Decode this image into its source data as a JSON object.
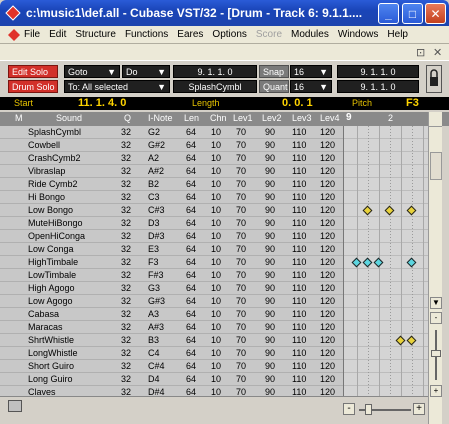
{
  "window": {
    "title": "c:\\music1\\def.all - Cubase VST/32 - [Drum - Track 6:  9.1.1....",
    "min_label": "_",
    "max_label": "□",
    "close_label": "✕"
  },
  "menu": [
    "File",
    "Edit",
    "Structure",
    "Functions",
    "Eares",
    "Options",
    "Score",
    "Modules",
    "Windows",
    "Help"
  ],
  "menu_disabled": "Score",
  "subwindow": {
    "restore_label": "⊡",
    "close_label": "✕",
    "min_label": "-"
  },
  "toolbar": {
    "edit_solo": "Edit Solo",
    "drum_solo": "Drum Solo",
    "goto": "Goto",
    "do": "Do",
    "to_selected": "To: All selected",
    "position1": "9.  1.  1.      0",
    "splash": "SplashCymbl",
    "snap_label": "Snap",
    "snap_value": "16",
    "quant_label": "Quant",
    "quant_value": "16",
    "pos_right1": "9.  1.  1.      0",
    "pos_right2": "9.  1.  1.      0",
    "dropdown_arrow": "▼"
  },
  "info": {
    "start_label": "Start",
    "start_value": "11. 1.  4.    0",
    "length_label": "Length",
    "length_value": "0.  0.    1",
    "pitch_label": "Pitch",
    "pitch_value": "F3"
  },
  "header": {
    "mute": "M",
    "sound": "Sound",
    "q": "Q",
    "inote": "I-Note",
    "len": "Len",
    "chn": "Chn",
    "lev1": "Lev1",
    "lev2": "Lev2",
    "lev3": "Lev3",
    "lev4": "Lev4",
    "bar9": "9",
    "beat2": "2"
  },
  "rows": [
    {
      "sound": "SplashCymbl",
      "q": "32",
      "note": "G2",
      "len": "64",
      "chn": "10",
      "l1": "70",
      "l2": "90",
      "l3": "110",
      "l4": "120"
    },
    {
      "sound": "Cowbell",
      "q": "32",
      "note": "G#2",
      "len": "64",
      "chn": "10",
      "l1": "70",
      "l2": "90",
      "l3": "110",
      "l4": "120"
    },
    {
      "sound": "CrashCymb2",
      "q": "32",
      "note": "A2",
      "len": "64",
      "chn": "10",
      "l1": "70",
      "l2": "90",
      "l3": "110",
      "l4": "120"
    },
    {
      "sound": "Vibraslap",
      "q": "32",
      "note": "A#2",
      "len": "64",
      "chn": "10",
      "l1": "70",
      "l2": "90",
      "l3": "110",
      "l4": "120"
    },
    {
      "sound": "Ride Cymb2",
      "q": "32",
      "note": "B2",
      "len": "64",
      "chn": "10",
      "l1": "70",
      "l2": "90",
      "l3": "110",
      "l4": "120"
    },
    {
      "sound": "Hi Bongo",
      "q": "32",
      "note": "C3",
      "len": "64",
      "chn": "10",
      "l1": "70",
      "l2": "90",
      "l3": "110",
      "l4": "120"
    },
    {
      "sound": "Low Bongo",
      "q": "32",
      "note": "C#3",
      "len": "64",
      "chn": "10",
      "l1": "70",
      "l2": "90",
      "l3": "110",
      "l4": "120"
    },
    {
      "sound": "MuteHiBongo",
      "q": "32",
      "note": "D3",
      "len": "64",
      "chn": "10",
      "l1": "70",
      "l2": "90",
      "l3": "110",
      "l4": "120"
    },
    {
      "sound": "OpenHiConga",
      "q": "32",
      "note": "D#3",
      "len": "64",
      "chn": "10",
      "l1": "70",
      "l2": "90",
      "l3": "110",
      "l4": "120"
    },
    {
      "sound": "Low Conga",
      "q": "32",
      "note": "E3",
      "len": "64",
      "chn": "10",
      "l1": "70",
      "l2": "90",
      "l3": "110",
      "l4": "120"
    },
    {
      "sound": "HighTimbale",
      "q": "32",
      "note": "F3",
      "len": "64",
      "chn": "10",
      "l1": "70",
      "l2": "90",
      "l3": "110",
      "l4": "120"
    },
    {
      "sound": "LowTimbale",
      "q": "32",
      "note": "F#3",
      "len": "64",
      "chn": "10",
      "l1": "70",
      "l2": "90",
      "l3": "110",
      "l4": "120"
    },
    {
      "sound": "High Agogo",
      "q": "32",
      "note": "G3",
      "len": "64",
      "chn": "10",
      "l1": "70",
      "l2": "90",
      "l3": "110",
      "l4": "120"
    },
    {
      "sound": "Low Agogo",
      "q": "32",
      "note": "G#3",
      "len": "64",
      "chn": "10",
      "l1": "70",
      "l2": "90",
      "l3": "110",
      "l4": "120"
    },
    {
      "sound": "Cabasa",
      "q": "32",
      "note": "A3",
      "len": "64",
      "chn": "10",
      "l1": "70",
      "l2": "90",
      "l3": "110",
      "l4": "120"
    },
    {
      "sound": "Maracas",
      "q": "32",
      "note": "A#3",
      "len": "64",
      "chn": "10",
      "l1": "70",
      "l2": "90",
      "l3": "110",
      "l4": "120"
    },
    {
      "sound": "ShrtWhistle",
      "q": "32",
      "note": "B3",
      "len": "64",
      "chn": "10",
      "l1": "70",
      "l2": "90",
      "l3": "110",
      "l4": "120"
    },
    {
      "sound": "LongWhistle",
      "q": "32",
      "note": "C4",
      "len": "64",
      "chn": "10",
      "l1": "70",
      "l2": "90",
      "l3": "110",
      "l4": "120"
    },
    {
      "sound": "Short Guiro",
      "q": "32",
      "note": "C#4",
      "len": "64",
      "chn": "10",
      "l1": "70",
      "l2": "90",
      "l3": "110",
      "l4": "120"
    },
    {
      "sound": "Long Guiro",
      "q": "32",
      "note": "D4",
      "len": "64",
      "chn": "10",
      "l1": "70",
      "l2": "90",
      "l3": "110",
      "l4": "120"
    },
    {
      "sound": "Claves",
      "q": "32",
      "note": "D#4",
      "len": "64",
      "chn": "10",
      "l1": "70",
      "l2": "90",
      "l3": "110",
      "l4": "120"
    }
  ],
  "notes": [
    {
      "row": 6,
      "step": 1,
      "color": "#e8d23a"
    },
    {
      "row": 6,
      "step": 3,
      "color": "#e8d23a"
    },
    {
      "row": 6,
      "step": 5,
      "color": "#e8d23a"
    },
    {
      "row": 10,
      "step": 0,
      "color": "#5cd6e0"
    },
    {
      "row": 10,
      "step": 1,
      "color": "#5cd6e0"
    },
    {
      "row": 10,
      "step": 2,
      "color": "#5cd6e0"
    },
    {
      "row": 10,
      "step": 5,
      "color": "#5cd6e0"
    },
    {
      "row": 16,
      "step": 4,
      "color": "#e8d23a"
    },
    {
      "row": 16,
      "step": 5,
      "color": "#e8d23a"
    }
  ],
  "colors": {
    "title_bar": "#1a45b8",
    "note_yellow": "#e8d23a",
    "note_cyan": "#5cd6e0",
    "solo_red": "#d2302a",
    "info_text": "#ffd400"
  },
  "scroll": {
    "up": "▲",
    "down": "▼",
    "plus": "+",
    "minus": "-"
  }
}
